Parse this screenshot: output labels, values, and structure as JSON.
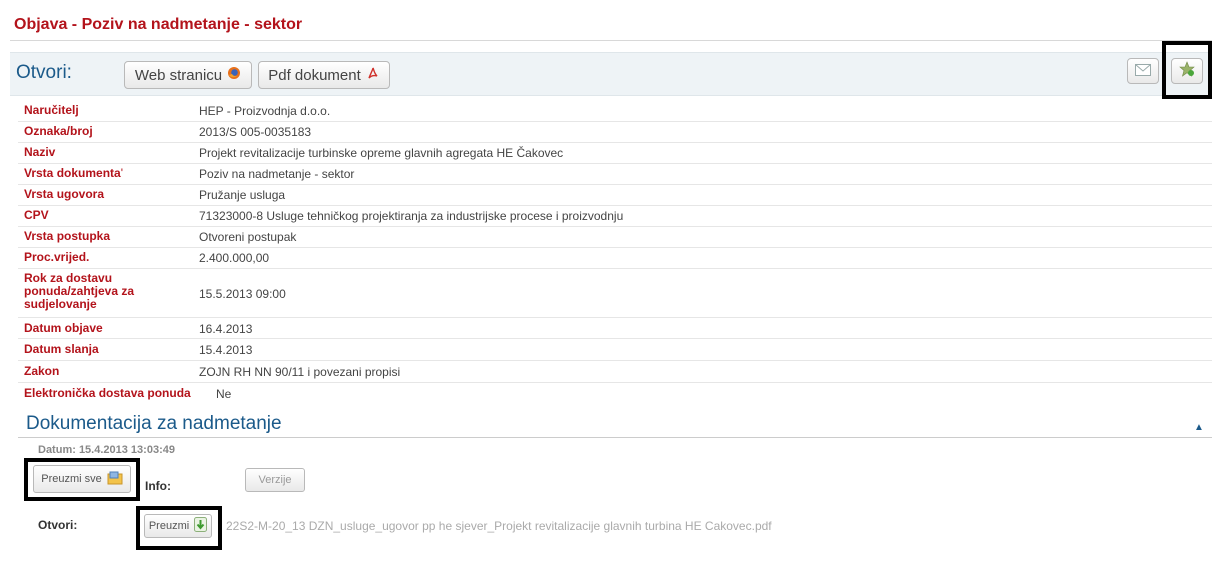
{
  "header": {
    "title": "Objava - Poziv na nadmetanje - sektor"
  },
  "toolbar": {
    "open_label": "Otvori:",
    "web_button": "Web stranicu",
    "pdf_button": "Pdf dokument",
    "mail_icon": "envelope-icon",
    "star_icon": "star-add-icon"
  },
  "details": [
    {
      "label": "Naručitelj",
      "value": "HEP - Proizvodnja d.o.o."
    },
    {
      "label": "Oznaka/broj",
      "value": "2013/S 005-0035183"
    },
    {
      "label": "Naziv",
      "value": "Projekt revitalizacije turbinske opreme glavnih agregata HE Čakovec"
    },
    {
      "label": "Vrsta dokumenta",
      "value": "Poziv na nadmetanje - sektor"
    },
    {
      "label": "Vrsta ugovora",
      "value": "Pružanje usluga"
    },
    {
      "label": "CPV",
      "value": "71323000-8 Usluge tehničkog projektiranja za industrijske procese i proizvodnju"
    },
    {
      "label": "Vrsta postupka",
      "value": "Otvoreni postupak"
    },
    {
      "label": "Proc.vrijed.",
      "value": "2.400.000,00"
    },
    {
      "label": "Rok za dostavu ponuda/zahtjeva za sudjelovanje",
      "value": "15.5.2013 09:00"
    },
    {
      "label": "Datum objave",
      "value": "16.4.2013"
    },
    {
      "label": "Datum slanja",
      "value": "15.4.2013"
    },
    {
      "label": "Zakon",
      "value": "ZOJN RH NN 90/11 i povezani propisi"
    },
    {
      "label": "Elektronička dostava ponuda",
      "value": "Ne"
    }
  ],
  "documentation": {
    "title": "Dokumentacija za nadmetanje",
    "date": "Datum: 15.4.2013 13:03:49",
    "download_all": "Preuzmi sve",
    "info_label": "Info:",
    "versions_button": "Verzije",
    "open_label": "Otvori:",
    "download_button": "Preuzmi",
    "filename": "22S2-M-20_13 DZN_usluge_ugovor pp he sjever_Projekt revitalizacije glavnih turbina HE Cakovec.pdf"
  }
}
